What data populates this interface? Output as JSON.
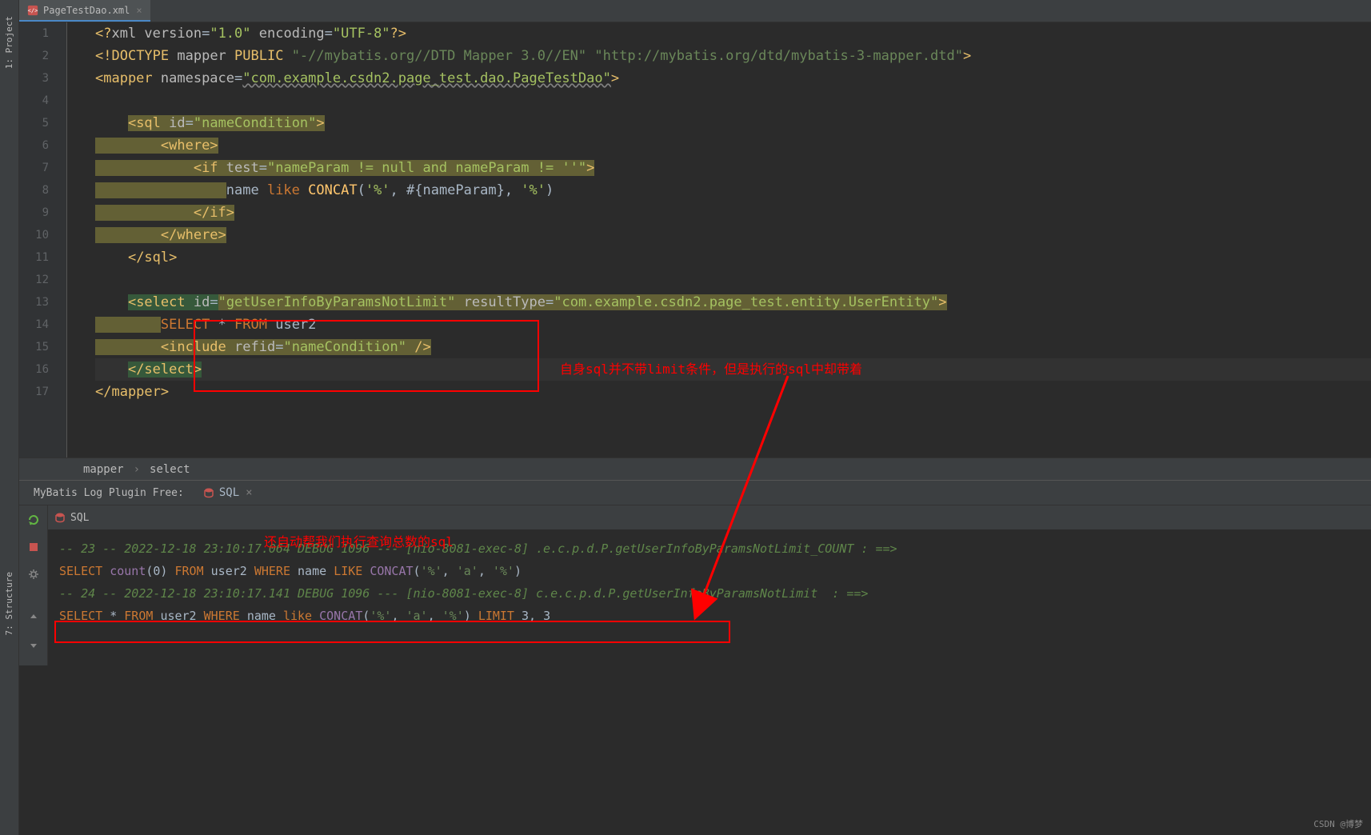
{
  "sidebar": {
    "project": "1: Project",
    "structure": "7: Structure"
  },
  "tab": {
    "name": "PageTestDao.xml",
    "close": "×"
  },
  "line_numbers": [
    "1",
    "2",
    "3",
    "4",
    "5",
    "6",
    "7",
    "8",
    "9",
    "10",
    "11",
    "12",
    "13",
    "14",
    "15",
    "16",
    "17"
  ],
  "code": {
    "l1": {
      "a": "<?",
      "b": "xml version",
      "c": "=",
      "d": "\"1.0\"",
      "e": " encoding",
      "f": "=",
      "g": "\"UTF-8\"",
      "h": "?>"
    },
    "l2": {
      "a": "<!",
      "b": "DOCTYPE ",
      "c": "mapper ",
      "d": "PUBLIC ",
      "e": "\"-//mybatis.org//DTD Mapper 3.0//EN\"",
      "f": " ",
      "g": "\"http://mybatis.org/dtd/mybatis-3-mapper.dtd\"",
      "h": ">"
    },
    "l3": {
      "a": "<mapper ",
      "b": "namespace",
      "c": "=",
      "d": "\"com.example.csdn2.page_test.dao.PageTestDao\"",
      "e": ">"
    },
    "l5": {
      "a": "<sql ",
      "b": "id",
      "c": "=",
      "d": "\"nameCondition\"",
      "e": ">"
    },
    "l6": {
      "a": "<where>"
    },
    "l7": {
      "a": "<if ",
      "b": "test",
      "c": "=",
      "d": "\"nameParam != null and nameParam != ''\"",
      "e": ">"
    },
    "l8": {
      "a": "name ",
      "b": "like ",
      "c": "CONCAT",
      "d": "(",
      "e": "'%'",
      "f": ", #{nameParam}, ",
      "g": "'%'",
      "h": ")"
    },
    "l9": {
      "a": "</if>"
    },
    "l10": {
      "a": "</where>"
    },
    "l11": {
      "a": "</sql>"
    },
    "l13": {
      "a": "<select ",
      "b": "id",
      "c": "=",
      "d": "\"getUserInfoByParamsNotLimit\"",
      "e": " resultType",
      "f": "=",
      "g": "\"com.example.csdn2.page_test.entity.UserEntity\"",
      "h": ">"
    },
    "l14": {
      "a": "SELECT ",
      "b": "* ",
      "c": "FROM ",
      "d": "user2"
    },
    "l15": {
      "a": "<include ",
      "b": "refid",
      "c": "=",
      "d": "\"nameCondition\"",
      "e": " />"
    },
    "l16": {
      "a": "</select>"
    },
    "l17": {
      "a": "</mapper>"
    }
  },
  "breadcrumb": {
    "a": "mapper",
    "b": "select"
  },
  "bottom": {
    "plugin_label": "MyBatis Log Plugin Free:",
    "tab": "SQL",
    "header": "SQL"
  },
  "annotations": {
    "note1": "自身sql并不带limit条件，但是执行的sql中却带着",
    "note2": "还自动帮我们执行查询总数的sql"
  },
  "log": {
    "l1": "-- 23 -- 2022-12-18 23:10:17.064 DEBUG 1096 --- [nio-8081-exec-8] .e.c.p.d.P.getUserInfoByParamsNotLimit_COUNT : ==>",
    "l2": {
      "a": "SELECT ",
      "b": "count",
      "c": "(0) ",
      "d": "FROM ",
      "e": "user2 ",
      "f": "WHERE ",
      "g": "name ",
      "h": "LIKE ",
      "i": "CONCAT",
      "j": "(",
      "k": "'%'",
      "l": ", ",
      "m": "'a'",
      "n": ", ",
      "o": "'%'",
      "p": ")"
    },
    "l3": "-- 24 -- 2022-12-18 23:10:17.141 DEBUG 1096 --- [nio-8081-exec-8] c.e.c.p.d.P.getUserInfoByParamsNotLimit  : ==>",
    "l4": {
      "a": "SELECT ",
      "b": "* ",
      "c": "FROM ",
      "d": "user2 ",
      "e": "WHERE ",
      "f": "name ",
      "g": "like ",
      "h": "CONCAT",
      "i": "(",
      "j": "'%'",
      "k": ", ",
      "l": "'a'",
      "m": ", ",
      "n": "'%'",
      "o": ") ",
      "p": "LIMIT ",
      "q": "3, 3"
    }
  },
  "watermark": "CSDN @博梦"
}
